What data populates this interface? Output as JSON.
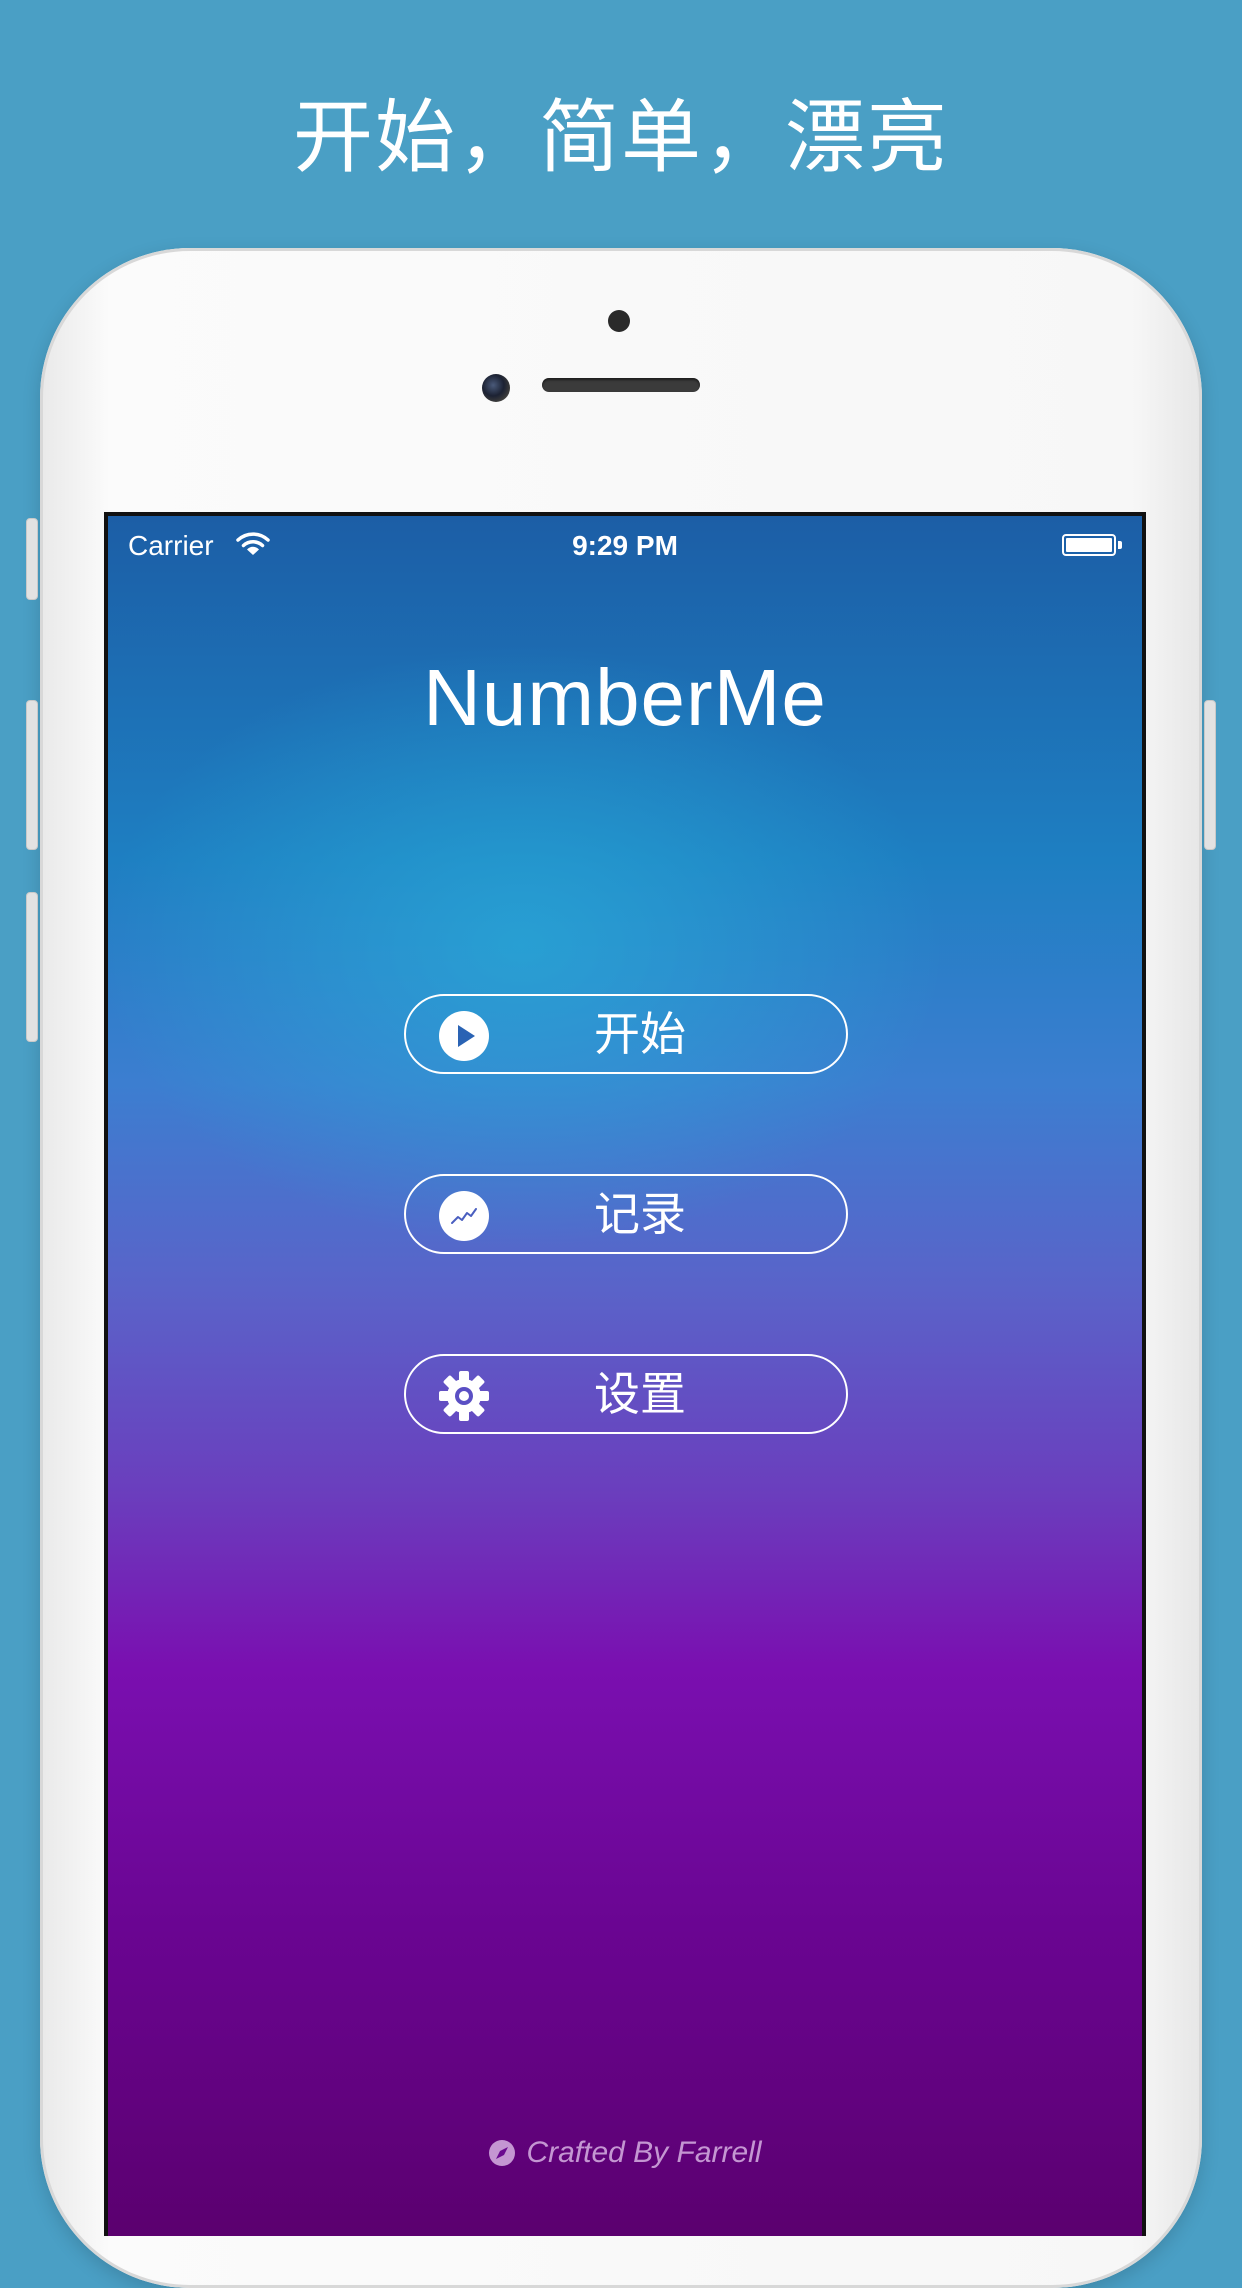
{
  "headline": "开始，简单，漂亮",
  "status_bar": {
    "carrier": "Carrier",
    "time": "9:29 PM"
  },
  "app": {
    "title": "NumberMe",
    "menu": [
      {
        "label": "开始",
        "icon": "play-icon"
      },
      {
        "label": "记录",
        "icon": "chart-icon"
      },
      {
        "label": "设置",
        "icon": "gear-icon"
      }
    ],
    "footer": "Crafted By Farrell"
  },
  "colors": {
    "page_background": "#4a9fc5",
    "gradient_top": "#1c5ea6",
    "gradient_mid": "#5a63c9",
    "gradient_purple": "#7a0fb0",
    "gradient_bottom": "#5b006f",
    "text": "#ffffff"
  }
}
